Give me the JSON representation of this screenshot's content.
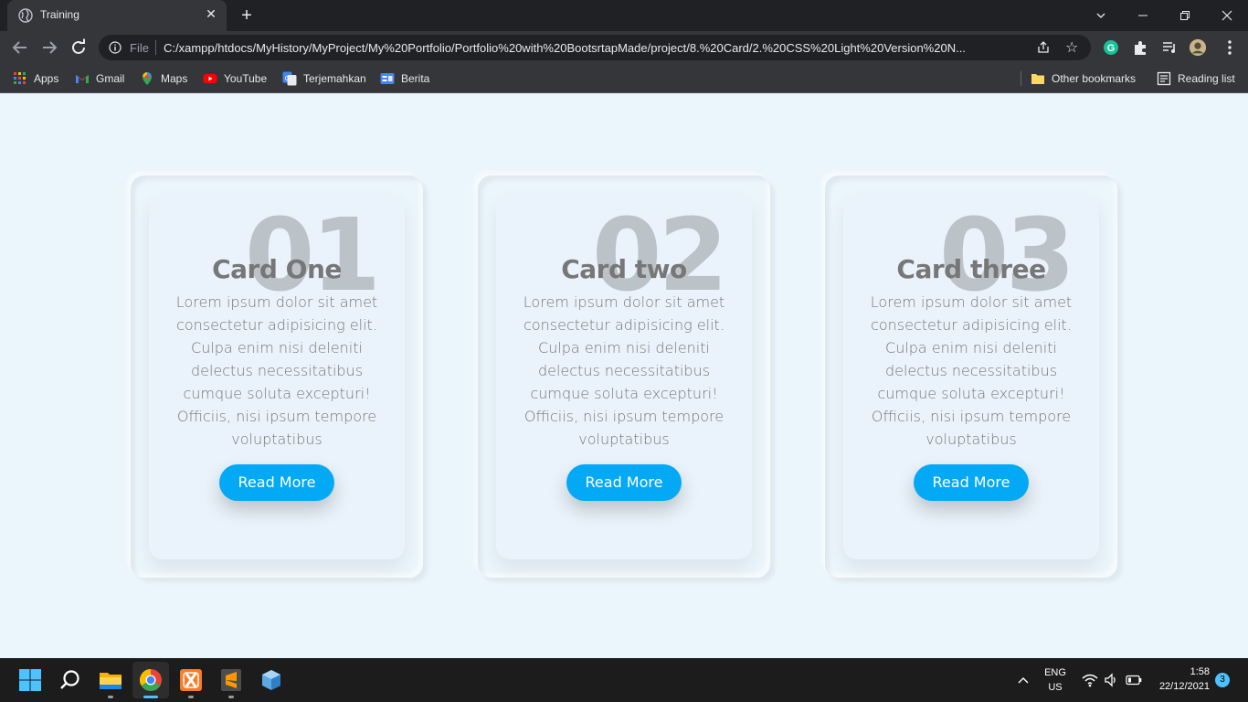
{
  "browser": {
    "tab_title": "Training",
    "address_scheme": "File",
    "url": "C:/xampp/htdocs/MyHistory/MyProject/My%20Portfolio/Portfolio%20with%20BootsrtapMade/project/8.%20Card/2.%20CSS%20Light%20Version%20N...",
    "bookmarks": [
      {
        "label": "Apps",
        "icon": "apps-grid-icon"
      },
      {
        "label": "Gmail",
        "icon": "gmail-icon"
      },
      {
        "label": "Maps",
        "icon": "maps-pin-icon"
      },
      {
        "label": "YouTube",
        "icon": "youtube-icon"
      },
      {
        "label": "Terjemahkan",
        "icon": "translate-icon"
      },
      {
        "label": "Berita",
        "icon": "news-icon"
      }
    ],
    "other_bookmarks": "Other bookmarks",
    "reading_list": "Reading list"
  },
  "cards": [
    {
      "number": "01",
      "title": "Card One",
      "text": "Lorem ipsum dolor sit amet consectetur adipisicing elit. Culpa enim nisi deleniti delectus necessitatibus cumque soluta excepturi! Officiis, nisi ipsum tempore voluptatibus",
      "button": "Read More"
    },
    {
      "number": "02",
      "title": "Card two",
      "text": "Lorem ipsum dolor sit amet consectetur adipisicing elit. Culpa enim nisi deleniti delectus necessitatibus cumque soluta excepturi! Officiis, nisi ipsum tempore voluptatibus",
      "button": "Read More"
    },
    {
      "number": "03",
      "title": "Card three",
      "text": "Lorem ipsum dolor sit amet consectetur adipisicing elit. Culpa enim nisi deleniti delectus necessitatibus cumque soluta excepturi! Officiis, nisi ipsum tempore voluptatibus",
      "button": "Read More"
    }
  ],
  "taskbar": {
    "language": "ENG",
    "region": "US",
    "time": "1:58",
    "date": "22/12/2021",
    "notifications": "3"
  },
  "colors": {
    "page_background": "#ebf5fc",
    "button": "#03a9f4",
    "text": "#777777"
  }
}
